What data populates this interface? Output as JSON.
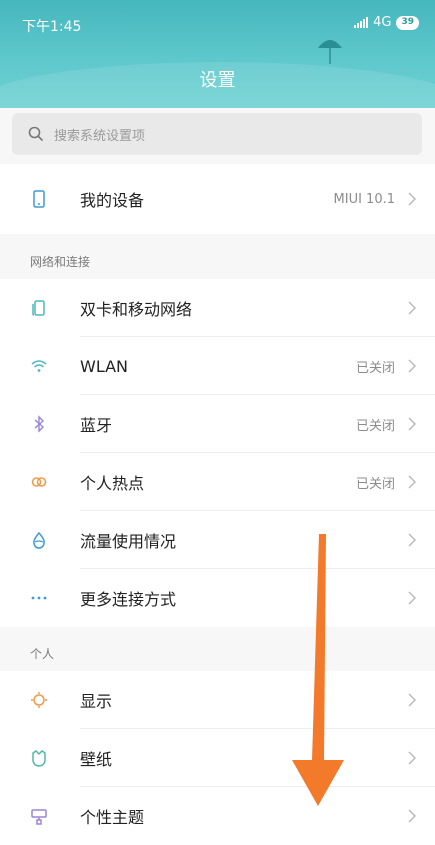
{
  "status_bar": {
    "time": "下午1:45",
    "network": "4G",
    "battery": "39"
  },
  "header": {
    "title": "设置"
  },
  "search": {
    "placeholder": "搜索系统设置项"
  },
  "device": {
    "label": "我的设备",
    "value": "MIUI 10.1"
  },
  "network_section": {
    "title": "网络和连接",
    "items": [
      {
        "label": "双卡和移动网络",
        "value": "",
        "icon": "sim-card-icon"
      },
      {
        "label": "WLAN",
        "value": "已关闭",
        "icon": "wifi-icon"
      },
      {
        "label": "蓝牙",
        "value": "已关闭",
        "icon": "bluetooth-icon"
      },
      {
        "label": "个人热点",
        "value": "已关闭",
        "icon": "hotspot-icon"
      },
      {
        "label": "流量使用情况",
        "value": "",
        "icon": "data-usage-icon"
      },
      {
        "label": "更多连接方式",
        "value": "",
        "icon": "more-icon"
      }
    ]
  },
  "personal_section": {
    "title": "个人",
    "items": [
      {
        "label": "显示",
        "value": "",
        "icon": "display-icon"
      },
      {
        "label": "壁纸",
        "value": "",
        "icon": "wallpaper-icon"
      },
      {
        "label": "个性主题",
        "value": "",
        "icon": "theme-icon"
      }
    ]
  },
  "colors": {
    "header": "#4fbdc2",
    "arrow": "#f47a2b",
    "accent_blue": "#3d9bd9"
  }
}
